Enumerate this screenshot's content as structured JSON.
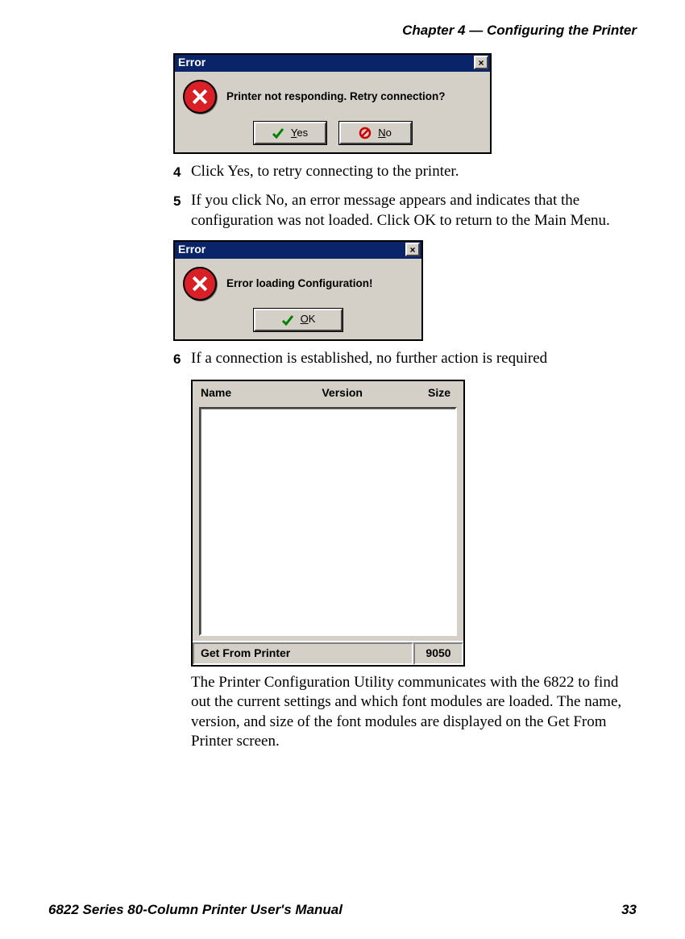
{
  "chapter_header": "Chapter 4 — Configuring the Printer",
  "footer": {
    "manual": "6822 Series 80-Column Printer User's Manual",
    "page": "33"
  },
  "dlg1": {
    "title": "Error",
    "message": "Printer not responding. Retry connection?",
    "yes": "Yes",
    "no": "No"
  },
  "step4": {
    "num": "4",
    "text": "Click Yes, to retry connecting to the printer."
  },
  "step5": {
    "num": "5",
    "text": "If you click No, an error message appears and indicates that the configuration was not loaded. Click OK to return to the Main Menu."
  },
  "dlg2": {
    "title": "Error",
    "message": "Error loading Configuration!",
    "ok": "OK"
  },
  "step6": {
    "num": "6",
    "text": "If a connection is established, no further action is required"
  },
  "font_panel": {
    "headers": {
      "name": "Name",
      "version": "Version",
      "size": "Size"
    },
    "status_left": "Get From Printer",
    "status_right": "9050"
  },
  "closing_para": "The Printer Configuration Utility communicates with the 6822 to find out the current settings and which font modules are loaded. The name, version, and size of the font modules are displayed on the Get From Printer screen."
}
